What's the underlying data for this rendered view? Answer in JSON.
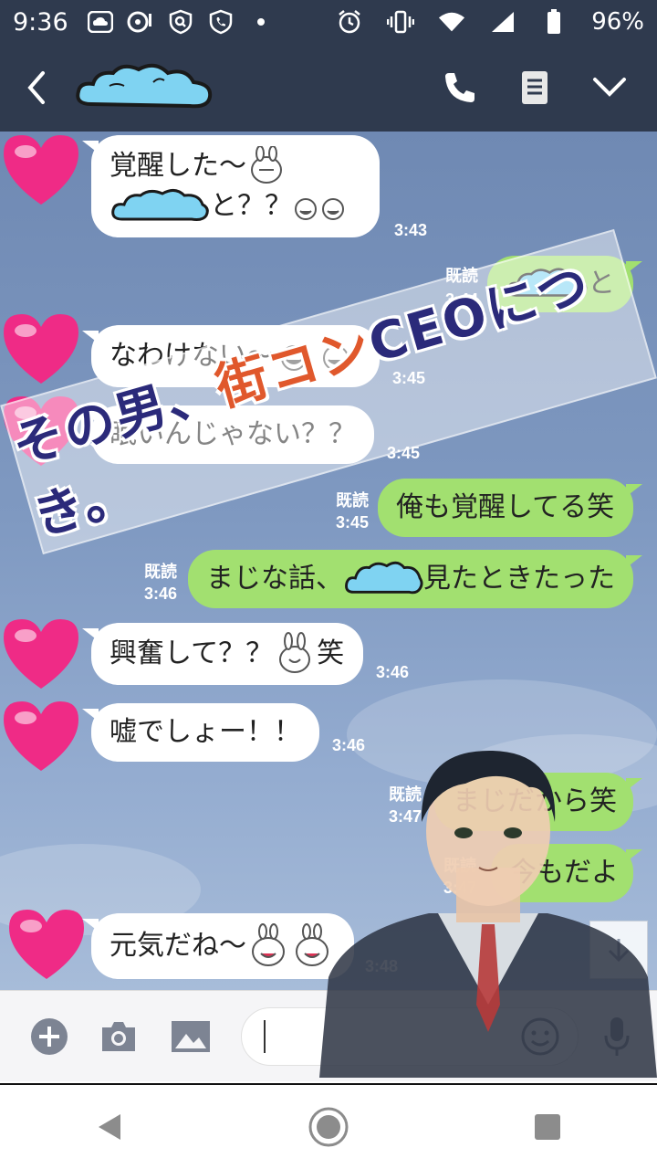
{
  "status_bar": {
    "time": "9:36",
    "battery": "96%"
  },
  "header": {
    "contact_name_censored": true
  },
  "watermark": {
    "text": "その男、街コンCEOにつき。",
    "part1": "その男、",
    "part2": "街コン",
    "part3": "CEOにつき。"
  },
  "messages": [
    {
      "id": "m1",
      "side": "in",
      "line1": "覚醒した〜",
      "line2": "と？？",
      "time": "3:43"
    },
    {
      "id": "m2",
      "side": "out",
      "text": "と",
      "read": "既読",
      "time": "3:44"
    },
    {
      "id": "m3",
      "side": "in",
      "text": "なわけない〜",
      "time": "3:45"
    },
    {
      "id": "m4",
      "side": "in",
      "text": "眠いんじゃない？？",
      "time": "3:45"
    },
    {
      "id": "m5",
      "side": "out",
      "text": "俺も覚醒してる笑",
      "read": "既読",
      "time": "3:45"
    },
    {
      "id": "m6",
      "side": "out",
      "text_a": "まじな話、",
      "text_b": "見たときたった",
      "read": "既読",
      "time": "3:46"
    },
    {
      "id": "m7",
      "side": "in",
      "text_a": "興奮して？？",
      "text_b": "笑",
      "time": "3:46"
    },
    {
      "id": "m8",
      "side": "in",
      "text": "嘘でしょー！！",
      "time": "3:46"
    },
    {
      "id": "m9",
      "side": "out",
      "text": "まじだから笑",
      "read": "既読",
      "time": "3:47"
    },
    {
      "id": "m10",
      "side": "out",
      "text": "今もだよ",
      "read": "既読",
      "time": "3:47"
    },
    {
      "id": "m11",
      "side": "in",
      "text": "元気だね〜",
      "time": "3:48"
    }
  ],
  "colors": {
    "header_bg": "#2f3a4e",
    "outgoing_bubble": "#a2e070",
    "incoming_bubble": "#ffffff",
    "chat_bg": "#7f99c1",
    "heart": "#ef2b86"
  },
  "icons": {
    "back": "back-icon",
    "call": "phone-icon",
    "notes": "notes-icon",
    "menu": "chevron-down-icon",
    "add": "plus-icon",
    "camera": "camera-icon",
    "image": "image-icon",
    "emoji": "emoji-icon",
    "mic": "mic-icon",
    "scroll": "arrow-down-icon"
  }
}
